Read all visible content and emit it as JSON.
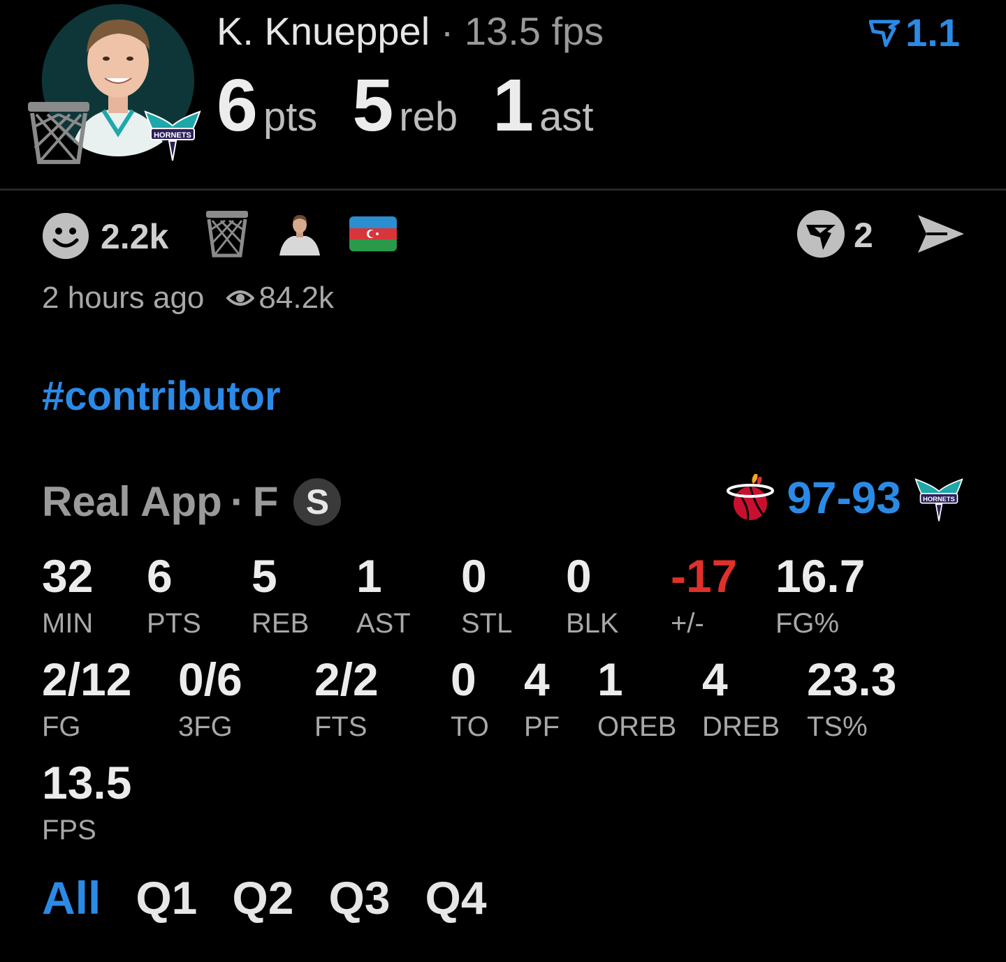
{
  "colors": {
    "background": "#000000",
    "accent": "#2b8ae6",
    "negative": "#e0302b",
    "muted": "#a8a8a8"
  },
  "header": {
    "player_name": "K. Knueppel",
    "separator": "·",
    "fps_text": "13.5 fps",
    "boost_value": "1.1",
    "boost_icon": "boost-arrow-icon",
    "team_badge_text": "HORNETS",
    "big_stats": [
      {
        "value": "6",
        "unit": "pts"
      },
      {
        "value": "5",
        "unit": "reb"
      },
      {
        "value": "1",
        "unit": "ast"
      }
    ]
  },
  "social": {
    "likes": "2.2k",
    "reaction_icon": "smile-icon",
    "v_count": "2",
    "posted": "2 hours ago",
    "views": "84.2k"
  },
  "hashtag": "#contributor",
  "game": {
    "source": "Real App",
    "separator": "·",
    "status": "F",
    "badge": "S",
    "score_home": "97",
    "score_dash": "-",
    "score_away": "93",
    "away_badge_text": "HORNETS"
  },
  "stats_row1": [
    {
      "value": "32",
      "label": "MIN"
    },
    {
      "value": "6",
      "label": "PTS"
    },
    {
      "value": "5",
      "label": "REB"
    },
    {
      "value": "1",
      "label": "AST"
    },
    {
      "value": "0",
      "label": "STL"
    },
    {
      "value": "0",
      "label": "BLK"
    },
    {
      "value": "-17",
      "label": "+/-"
    },
    {
      "value": "16.7",
      "label": "FG%"
    }
  ],
  "stats_row2": [
    {
      "value": "2/12",
      "label": "FG"
    },
    {
      "value": "0/6",
      "label": "3FG"
    },
    {
      "value": "2/2",
      "label": "FTS"
    },
    {
      "value": "0",
      "label": "TO"
    },
    {
      "value": "4",
      "label": "PF"
    },
    {
      "value": "1",
      "label": "OREB"
    },
    {
      "value": "4",
      "label": "DREB"
    },
    {
      "value": "23.3",
      "label": "TS%"
    }
  ],
  "stats_row3": [
    {
      "value": "13.5",
      "label": "FPS"
    }
  ],
  "tabs": [
    {
      "label": "All",
      "active": true
    },
    {
      "label": "Q1",
      "active": false
    },
    {
      "label": "Q2",
      "active": false
    },
    {
      "label": "Q3",
      "active": false
    },
    {
      "label": "Q4",
      "active": false
    }
  ]
}
